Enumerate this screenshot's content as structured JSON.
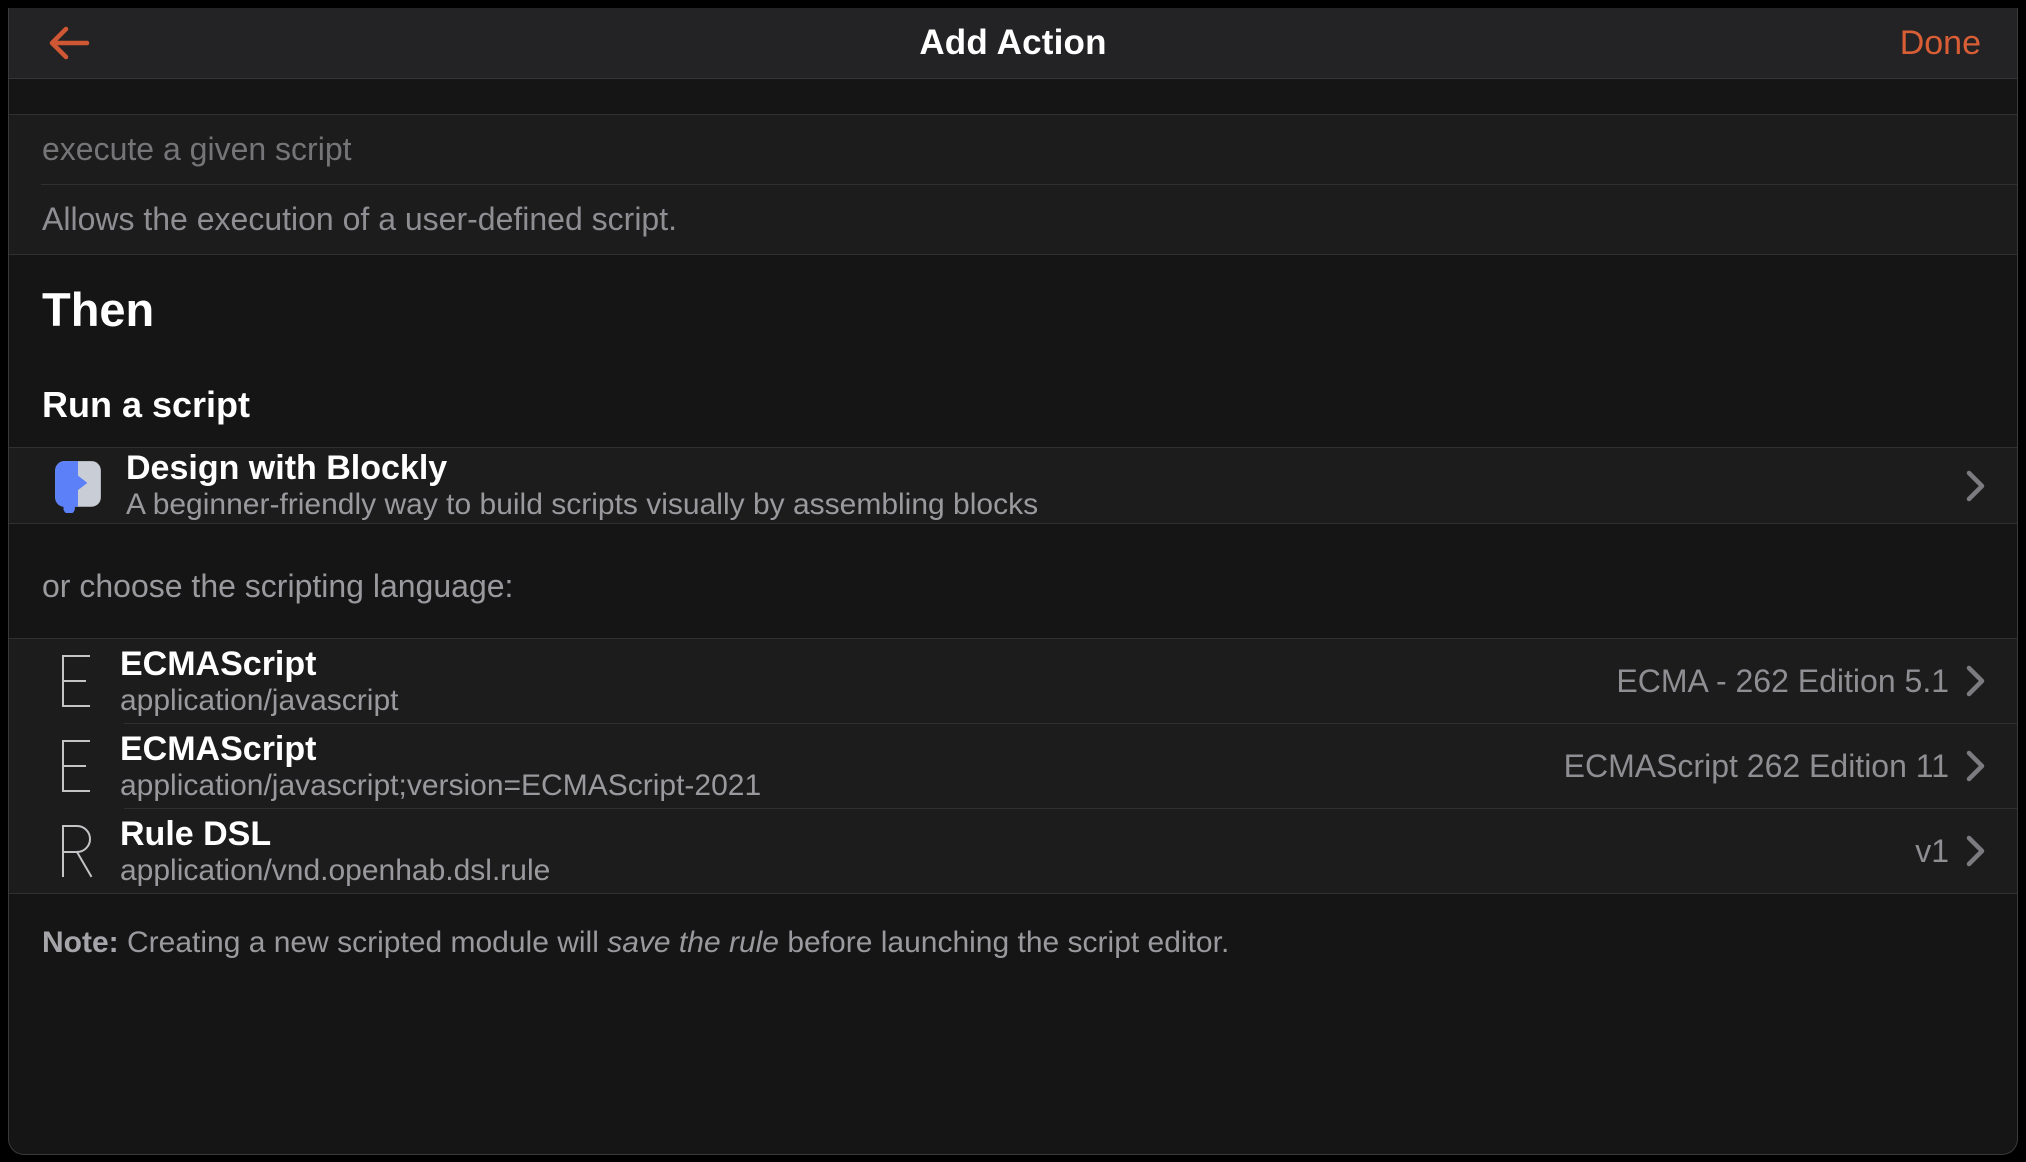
{
  "colors": {
    "accent_orange": "#d95e36",
    "sheet_bg": "#151516",
    "block_bg": "#1c1c1d",
    "navbar_bg": "#232325",
    "blockly_blue": "#5b80f7",
    "blockly_gray": "#c9ced6"
  },
  "navbar": {
    "title": "Add Action",
    "back_icon": "left-arrow",
    "done_label": "Done"
  },
  "module": {
    "name_placeholder": "execute a given script",
    "description": "Allows the execution of a user-defined script."
  },
  "section": {
    "heading": "Then",
    "subheading": "Run a script"
  },
  "blockly": {
    "icon": "blockly-logo",
    "title": "Design with Blockly",
    "subtitle": "A beginner-friendly way to build scripts visually by assembling blocks",
    "chevron_icon": "chevron-right"
  },
  "choose_label": "or choose the scripting language:",
  "languages": [
    {
      "icon": "E",
      "title": "ECMAScript",
      "subtitle": "application/javascript",
      "version": "ECMA - 262 Edition 5.1"
    },
    {
      "icon": "E",
      "title": "ECMAScript",
      "subtitle": "application/javascript;version=ECMAScript-2021",
      "version": "ECMAScript 262 Edition 11"
    },
    {
      "icon": "R",
      "title": "Rule DSL",
      "subtitle": "application/vnd.openhab.dsl.rule",
      "version": "v1"
    }
  ],
  "note": {
    "label": "Note:",
    "text_before_italic": " Creating a new scripted module will ",
    "italic": "save the rule",
    "text_after_italic": " before launching the script editor."
  }
}
